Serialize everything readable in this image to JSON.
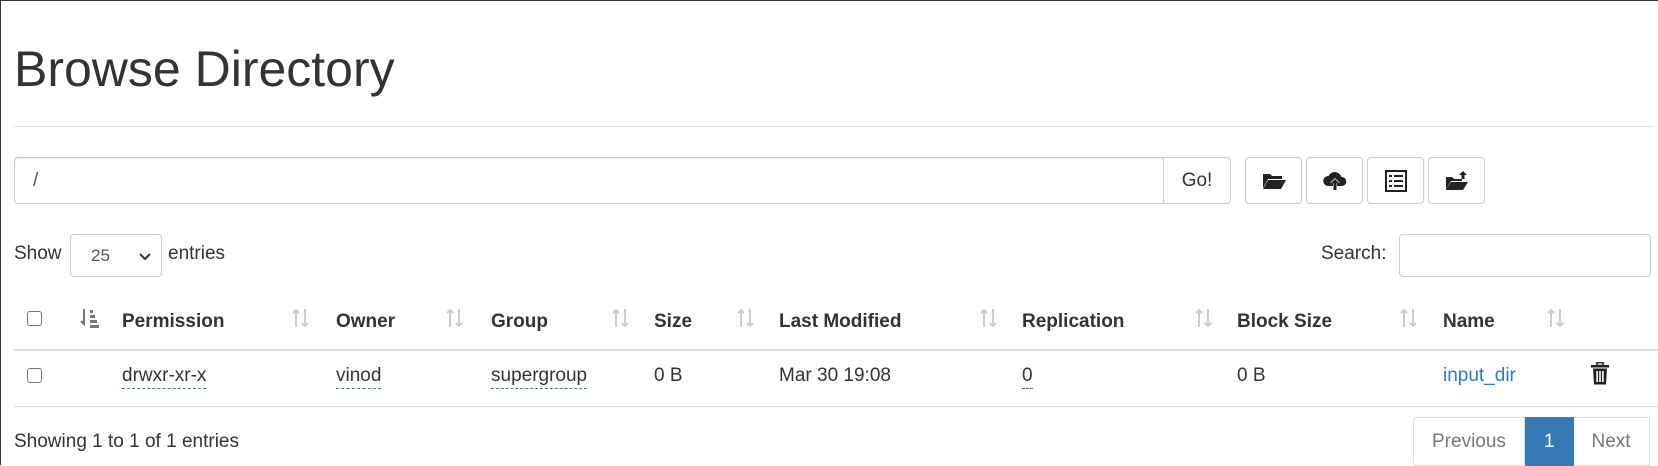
{
  "page": {
    "title": "Browse Directory"
  },
  "toolbar": {
    "path_value": "/",
    "go_label": "Go!",
    "buttons": [
      "folder-open-icon",
      "cloud-upload-icon",
      "list-alt-icon",
      "folder-move-icon"
    ]
  },
  "controls": {
    "show_label": "Show",
    "entries_value": "25",
    "entries_label": "entries",
    "search_label": "Search:"
  },
  "table": {
    "columns": [
      "Permission",
      "Owner",
      "Group",
      "Size",
      "Last Modified",
      "Replication",
      "Block Size",
      "Name"
    ],
    "rows": [
      {
        "permission": "drwxr-xr-x",
        "owner": "vinod",
        "group": "supergroup",
        "size": "0 B",
        "last_modified": "Mar 30 19:08",
        "replication": "0",
        "block_size": "0 B",
        "name": "input_dir"
      }
    ]
  },
  "footer": {
    "info": "Showing 1 to 1 of 1 entries",
    "previous": "Previous",
    "current_page": "1",
    "next": "Next"
  },
  "colors": {
    "link": "#337ab7",
    "active_page": "#337ab7",
    "border": "#cccccc"
  }
}
